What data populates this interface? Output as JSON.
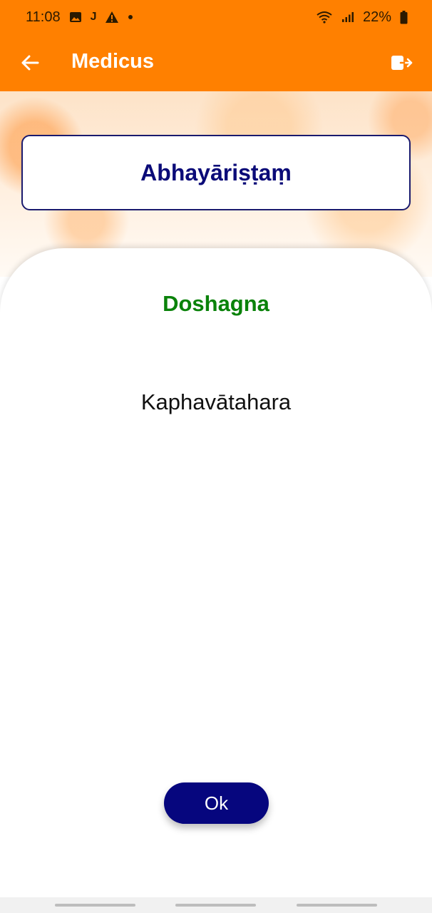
{
  "status_bar": {
    "time": "11:08",
    "left_icons": [
      "gallery-icon",
      "j-app-icon",
      "warning-icon",
      "dot-icon"
    ],
    "j_glyph": "J",
    "battery_percent": "22%",
    "right_icons": [
      "wifi-icon",
      "signal-icon",
      "battery-icon"
    ]
  },
  "app_bar": {
    "title": "Medicus",
    "back_icon": "arrow-left-icon",
    "logout_icon": "logout-icon"
  },
  "main": {
    "name": "Abhayāriṣṭaṃ",
    "section_heading": "Doshagna",
    "section_value": "Kaphavātahara"
  },
  "actions": {
    "ok_label": "Ok"
  },
  "colors": {
    "primary_orange": "#ff8000",
    "title_navy": "#0b0b78",
    "heading_green": "#0a820a",
    "button_navy": "#06067e"
  }
}
